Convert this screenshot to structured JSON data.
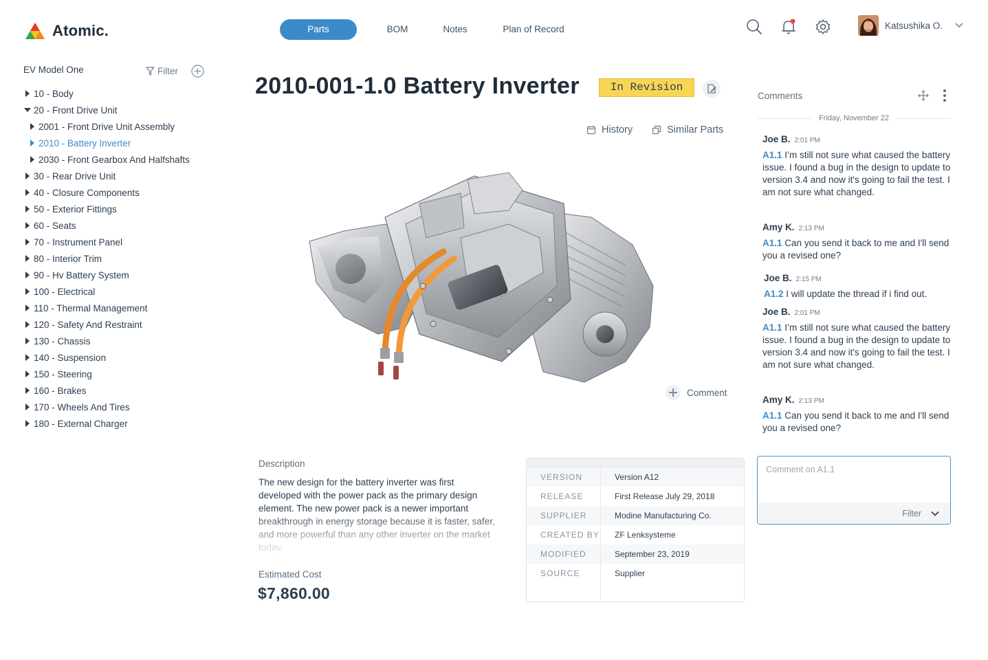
{
  "app": {
    "name": "Atomic."
  },
  "nav": {
    "tabs": [
      "Parts",
      "BOM",
      "Notes",
      "Plan of Record"
    ],
    "active": "Parts"
  },
  "header": {
    "icons": [
      "search-icon",
      "bell-icon",
      "gear-icon"
    ],
    "notification_dot_color": "#e24b4b"
  },
  "user": {
    "name": "Katsushika O."
  },
  "sidebar": {
    "title": "EV Model One",
    "filter_label": "Filter",
    "items": [
      {
        "label": "10 - Body",
        "level": 0,
        "state": "collapsed"
      },
      {
        "label": "20 - Front Drive Unit",
        "level": 0,
        "state": "expanded"
      },
      {
        "label": "2001 - Front Drive Unit Assembly",
        "level": 1,
        "state": "collapsed"
      },
      {
        "label": "2010 - Battery Inverter",
        "level": 1,
        "state": "collapsed",
        "selected": true
      },
      {
        "label": "2030 - Front Gearbox And Halfshafts",
        "level": 1,
        "state": "collapsed"
      },
      {
        "label": "30 - Rear Drive Unit",
        "level": 0,
        "state": "collapsed"
      },
      {
        "label": "40 - Closure Components",
        "level": 0,
        "state": "collapsed"
      },
      {
        "label": "50 - Exterior Fittings",
        "level": 0,
        "state": "collapsed"
      },
      {
        "label": "60 - Seats",
        "level": 0,
        "state": "collapsed"
      },
      {
        "label": "70 - Instrument Panel",
        "level": 0,
        "state": "collapsed"
      },
      {
        "label": "80 - Interior Trim",
        "level": 0,
        "state": "collapsed"
      },
      {
        "label": "90 - Hv Battery System",
        "level": 0,
        "state": "collapsed"
      },
      {
        "label": "100 - Electrical",
        "level": 0,
        "state": "collapsed"
      },
      {
        "label": "110 - Thermal Management",
        "level": 0,
        "state": "collapsed"
      },
      {
        "label": "120 - Safety And Restraint",
        "level": 0,
        "state": "collapsed"
      },
      {
        "label": "130 - Chassis",
        "level": 0,
        "state": "collapsed"
      },
      {
        "label": "140 - Suspension",
        "level": 0,
        "state": "collapsed"
      },
      {
        "label": "150 - Steering",
        "level": 0,
        "state": "collapsed"
      },
      {
        "label": "160 - Brakes",
        "level": 0,
        "state": "collapsed"
      },
      {
        "label": "170 - Wheels And Tires",
        "level": 0,
        "state": "collapsed"
      },
      {
        "label": "180 - External Charger",
        "level": 0,
        "state": "collapsed"
      }
    ]
  },
  "part": {
    "title": "2010-001-1.0 Battery Inverter",
    "status": "In Revision",
    "status_color": "#f7d654",
    "actions": {
      "history": "History",
      "similar": "Similar Parts"
    },
    "comment_label": "Comment",
    "description_label": "Description",
    "description": "The new design for the battery inverter was first developed with the power pack as the primary design element. The new power pack is a newer important breakthrough in energy storage because it is faster, safer, and more powerful than any other inverter on the market today.",
    "cost_label": "Estimated  Cost",
    "cost": "$7,860.00",
    "properties": [
      {
        "key": "VERSION",
        "value": "Version A12"
      },
      {
        "key": "RELEASE",
        "value": "First Release  July 29, 2018"
      },
      {
        "key": "SUPPLIER",
        "value": "Modine Manufacturing Co."
      },
      {
        "key": "CREATED BY",
        "value": "ZF Lenksysteme"
      },
      {
        "key": "MODIFIED",
        "value": "September 23, 2019"
      },
      {
        "key": "SOURCE",
        "value": "Supplier"
      }
    ]
  },
  "comments": {
    "title": "Comments",
    "date": "Friday, November 22",
    "items": [
      {
        "author": "Joe B.",
        "time": "2:01 PM",
        "ref": "A1.1",
        "text": "I’m still not sure what caused the battery issue. I found a bug in the design to update to version 3.4 and now it's going to fail the test. I am not sure what changed."
      },
      {
        "author": "Amy K.",
        "time": "2:13 PM",
        "ref": "A1.1",
        "text": "Can you send it back to me and I'll send you a revised one?"
      },
      {
        "author": "Joe B.",
        "time": "2:15 PM",
        "ref": "A1.2",
        "text": " I will update the thread if i find out."
      },
      {
        "author": "Joe B.",
        "time": "2:01 PM",
        "ref": "A1.1",
        "text": "I’m still not sure what caused the battery issue. I found a bug in the design to update to version 3.4 and now it's going to fail the test. I am not sure what changed."
      },
      {
        "author": "Amy K.",
        "time": "2:13 PM",
        "ref": "A1.1",
        "text": "Can you send it back to me and I'll send you a revised one?"
      }
    ],
    "input_placeholder": "Comment on A1.1",
    "input_filter_label": "Filter"
  }
}
